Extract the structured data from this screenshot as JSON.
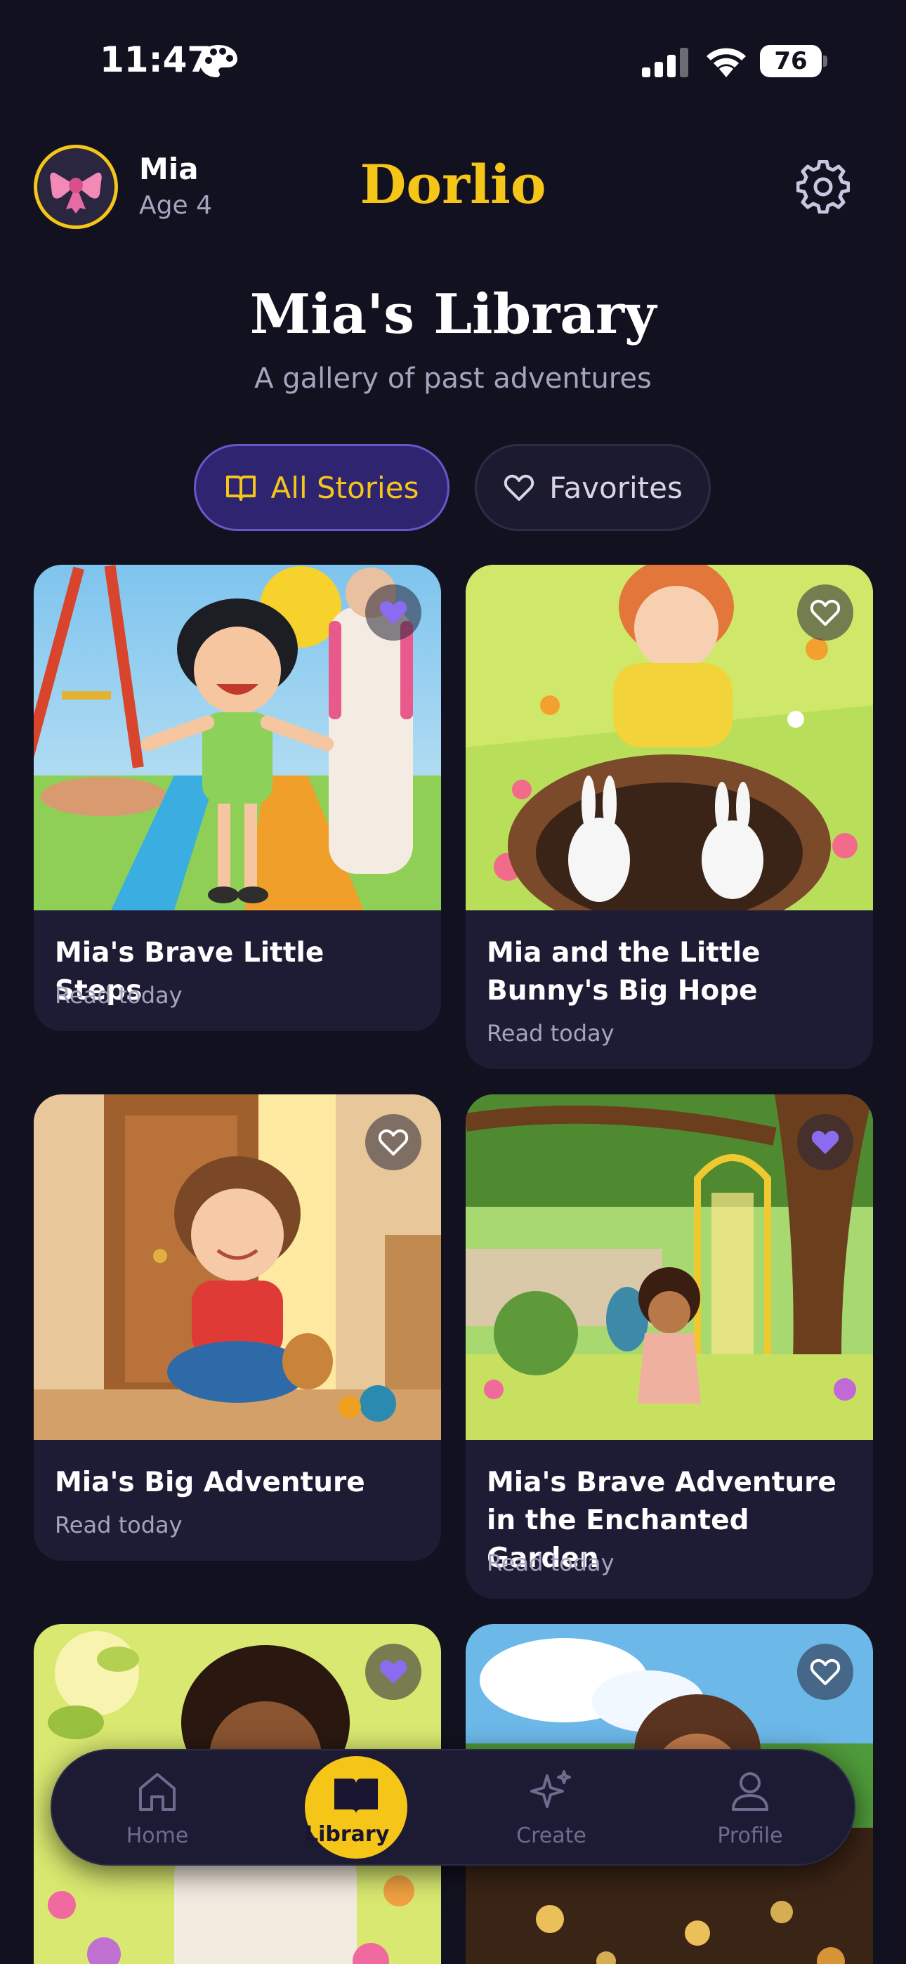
{
  "status_bar": {
    "time": "11:47",
    "battery": "76"
  },
  "header": {
    "profile_name": "Mia",
    "profile_age": "Age 4",
    "brand": "Dorlio"
  },
  "page": {
    "title": "Mia's Library",
    "subtitle": "A gallery of past adventures"
  },
  "filters": [
    {
      "label": "All Stories",
      "active": true
    },
    {
      "label": "Favorites",
      "active": false
    }
  ],
  "stories": [
    {
      "title": "Mia's Brave Little Steps",
      "meta": "Read today",
      "favorite": true
    },
    {
      "title": "Mia and the Little Bunny's Big Hope",
      "meta": "Read today",
      "favorite": false
    },
    {
      "title": "Mia's Big Adventure",
      "meta": "Read today",
      "favorite": false
    },
    {
      "title": "Mia's Brave Adventure in the Enchanted Garden",
      "meta": "Read today",
      "favorite": true
    },
    {
      "title": "",
      "meta": "",
      "favorite": true
    },
    {
      "title": "",
      "meta": "",
      "favorite": false
    }
  ],
  "nav": [
    {
      "label": "Home",
      "icon": "home-icon",
      "active": false
    },
    {
      "label": "Library",
      "icon": "book-icon",
      "active": true
    },
    {
      "label": "Create",
      "icon": "sparkle-icon",
      "active": false
    },
    {
      "label": "Profile",
      "icon": "person-icon",
      "active": false
    }
  ],
  "colors": {
    "background": "#12111f",
    "accent_yellow": "#f5c518",
    "accent_purple": "#8b6cf0",
    "card": "#1e1b35"
  }
}
